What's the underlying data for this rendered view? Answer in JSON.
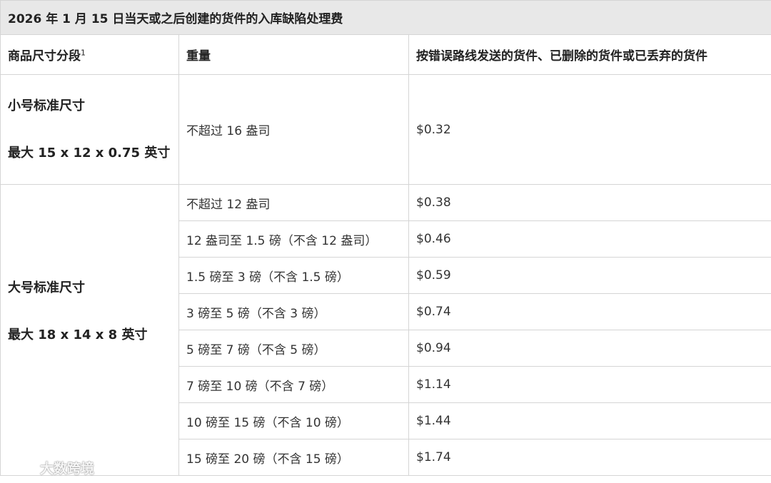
{
  "table": {
    "title": "2026 年 1 月 15 日当天或之后创建的货件的入库缺陷处理费",
    "headers": {
      "tier": "商品尺寸分段",
      "tier_footnote": "1",
      "weight": "重量",
      "fee": "按错误路线发送的货件、已删除的货件或已丢弃的货件"
    },
    "small_standard": {
      "name": "小号标准尺寸",
      "dims": "最大 15 x 12 x 0.75 英寸",
      "rows": [
        {
          "weight": "不超过 16 盎司",
          "fee": "$0.32"
        }
      ]
    },
    "large_standard": {
      "name": "大号标准尺寸",
      "dims": "最大 18 x 14 x 8 英寸",
      "rows": [
        {
          "weight": "不超过 12 盎司",
          "fee": "$0.38"
        },
        {
          "weight": "12 盎司至 1.5 磅（不含 12 盎司）",
          "fee": "$0.46"
        },
        {
          "weight": "1.5 磅至 3 磅（不含 1.5 磅）",
          "fee": "$0.59"
        },
        {
          "weight": "3 磅至 5 磅（不含 3 磅）",
          "fee": "$0.74"
        },
        {
          "weight": "5 磅至 7 磅（不含 5 磅）",
          "fee": "$0.94"
        },
        {
          "weight": "7 磅至 10 磅（不含 7 磅）",
          "fee": "$1.14"
        },
        {
          "weight": "10 磅至 15 磅（不含 10 磅）",
          "fee": "$1.44"
        },
        {
          "weight": "15 磅至 20 磅（不含 15 磅）",
          "fee": "$1.74"
        }
      ]
    }
  },
  "watermark": {
    "text": "大数跨境",
    "icon": "brand-logo-icon"
  }
}
